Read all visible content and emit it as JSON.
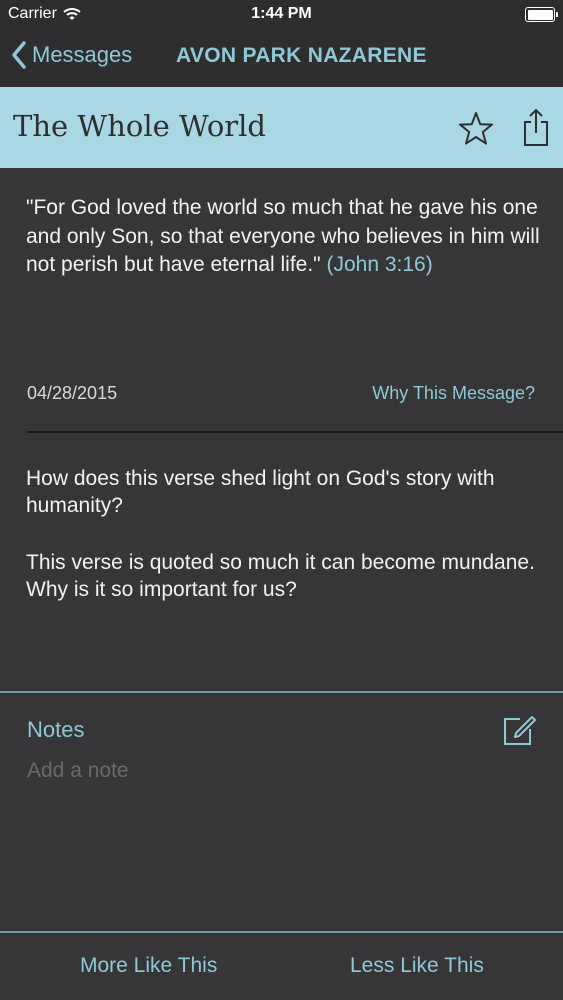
{
  "status_bar": {
    "carrier": "Carrier",
    "time": "1:44 PM",
    "icons": [
      "wifi-icon",
      "battery-icon"
    ]
  },
  "nav": {
    "back_label": "Messages",
    "title": "AVON PARK NAZARENE"
  },
  "message": {
    "title": "The Whole World",
    "verse_text": "\"For God loved the world so much that he gave his one and only Son, so that everyone who believes in him will not perish but have eternal life.\" ",
    "verse_reference": "(John 3:16)",
    "date": "04/28/2015",
    "why_link": "Why This Message?",
    "questions": [
      "How does this verse shed light on God's story with humanity?",
      "This verse is quoted so much it can become mundane. Why is it so important for us?"
    ]
  },
  "notes": {
    "label": "Notes",
    "placeholder": "Add a note",
    "value": ""
  },
  "footer": {
    "more_label": "More Like This",
    "less_label": "Less Like This"
  },
  "colors": {
    "background": "#363638",
    "bar": "#2e2e30",
    "header_band": "#a9d8e4",
    "accent": "#8fc8d6",
    "divider": "#6e9ba6"
  }
}
